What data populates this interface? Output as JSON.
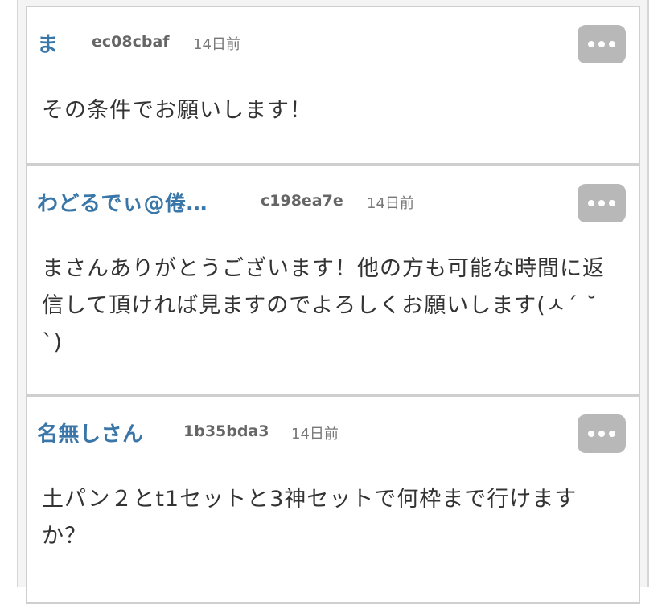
{
  "comments": [
    {
      "author": "ま",
      "user_id": "ec08cbaf",
      "time": "14日前",
      "text": "その条件でお願いします！"
    },
    {
      "author": "わどるでぃ@倦…",
      "user_id": "c198ea7e",
      "time": "14日前",
      "text": "まさんありがとうございます！他の方も可能な時間に返信して頂ければ見ますのでよろしくお願いします(ㅅ´ ˘ `)"
    },
    {
      "author": "名無しさん",
      "user_id": "1b35bda3",
      "time": "14日前",
      "text": "土パン２とt1セットと3神セットで何枠まで行けますか？"
    }
  ],
  "icons": {
    "more": "more-options-icon"
  },
  "colors": {
    "author": "#3a77a8",
    "more_button": "#b8b8b8",
    "border": "#cfcfcf"
  }
}
